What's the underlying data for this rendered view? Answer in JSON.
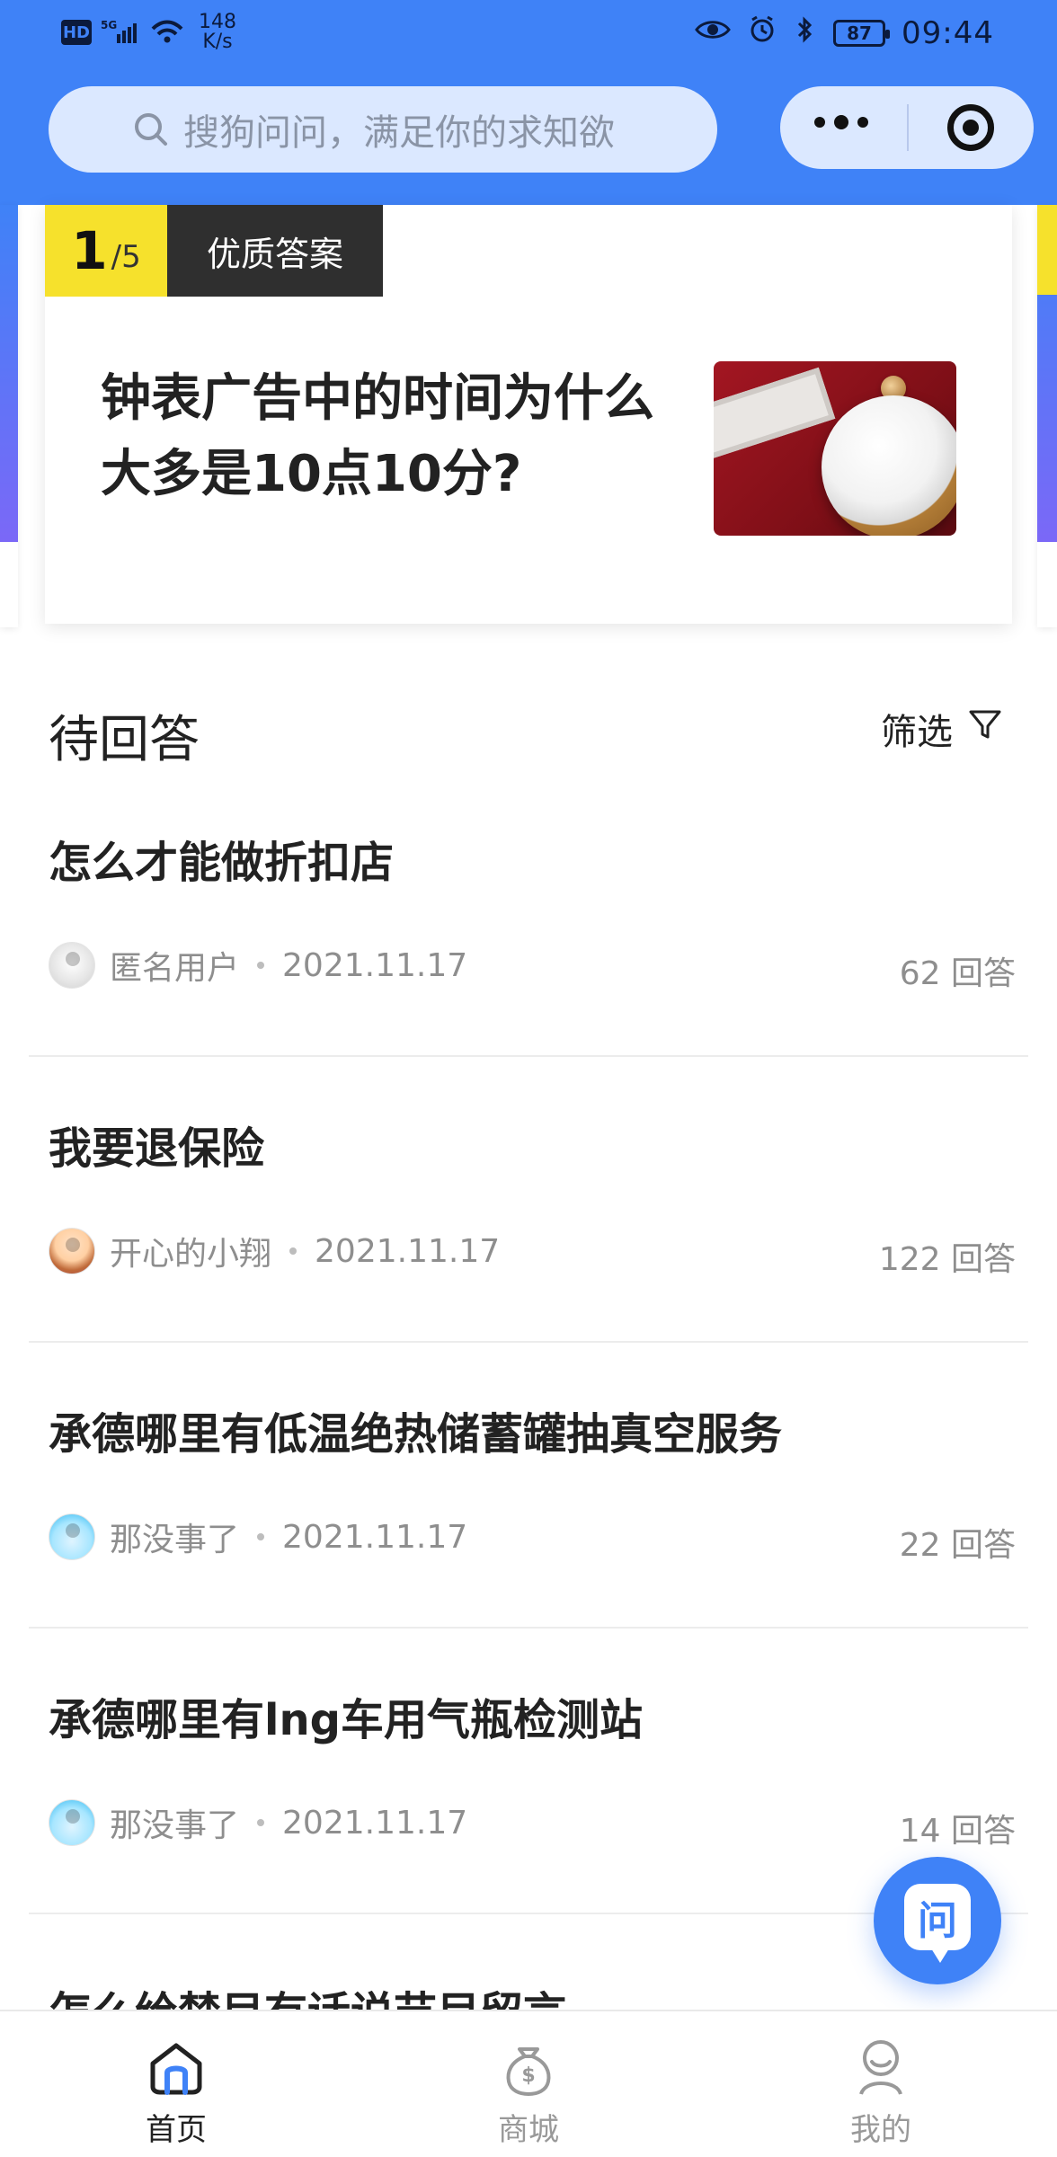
{
  "status_bar": {
    "hd": "HD",
    "network": "5G",
    "speed_top": "148",
    "speed_bottom": "K/s",
    "battery": "87",
    "time": "09:44"
  },
  "search": {
    "placeholder": "搜狗问问，满足你的求知欲"
  },
  "carousel": {
    "index": "1",
    "total": "/5",
    "badge": "优质答案",
    "title": "钟表广告中的时间为什么大多是10点10分?"
  },
  "section": {
    "title": "待回答",
    "filter_label": "筛选"
  },
  "questions": [
    {
      "title": "怎么才能做折扣店",
      "author": "匿名用户",
      "date": "2021.11.17",
      "answers": "62 回答"
    },
    {
      "title": "我要退保险",
      "author": "开心的小翔",
      "date": "2021.11.17",
      "answers": "122 回答"
    },
    {
      "title": "承德哪里有低温绝热储蓄罐抽真空服务",
      "author": "那没事了",
      "date": "2021.11.17",
      "answers": "22 回答"
    },
    {
      "title": "承德哪里有lng车用气瓶检测站",
      "author": "那没事了",
      "date": "2021.11.17",
      "answers": "14 回答"
    }
  ],
  "partial_question": "怎么给禁目有话说节目留言",
  "fab": {
    "label": "问"
  },
  "bottom_nav": [
    {
      "label": "首页"
    },
    {
      "label": "商城"
    },
    {
      "label": "我的"
    }
  ],
  "colors": {
    "primary": "#3f82f7",
    "badge_yellow": "#f6e12c",
    "text_dark": "#222222",
    "text_gray": "#8e8e8e"
  }
}
